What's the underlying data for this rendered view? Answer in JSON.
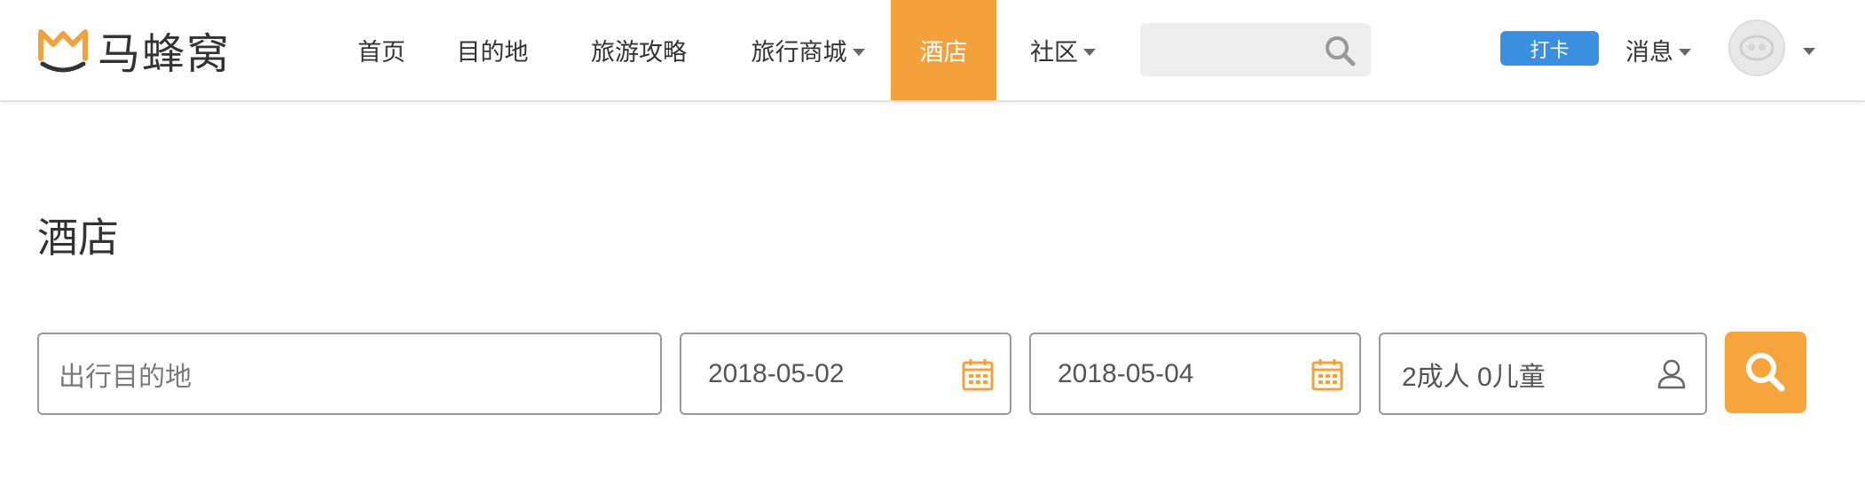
{
  "brand": {
    "name": "马蜂窝"
  },
  "nav": {
    "items": [
      {
        "label": "首页",
        "has_dropdown": false,
        "active": false
      },
      {
        "label": "目的地",
        "has_dropdown": false,
        "active": false
      },
      {
        "label": "旅游攻略",
        "has_dropdown": false,
        "active": false
      },
      {
        "label": "旅行商城",
        "has_dropdown": true,
        "active": false
      },
      {
        "label": "酒店",
        "has_dropdown": false,
        "active": true
      },
      {
        "label": "社区",
        "has_dropdown": true,
        "active": false
      }
    ],
    "search_placeholder": "",
    "checkin_label": "打卡",
    "messages_label": "消息"
  },
  "page": {
    "title": "酒店"
  },
  "search_form": {
    "destination_placeholder": "出行目的地",
    "checkin_date": "2018-05-02",
    "checkout_date": "2018-05-04",
    "guests": "2成人 0儿童"
  },
  "colors": {
    "accent": "#f4a13c",
    "checkin_button": "#3b8fe0",
    "nav_background": "#ffffff"
  },
  "icons": {
    "logo": "mafengwo-logo-icon",
    "nav_search": "search-icon",
    "date": "calendar-icon",
    "guests": "user-icon",
    "submit": "search-icon"
  }
}
